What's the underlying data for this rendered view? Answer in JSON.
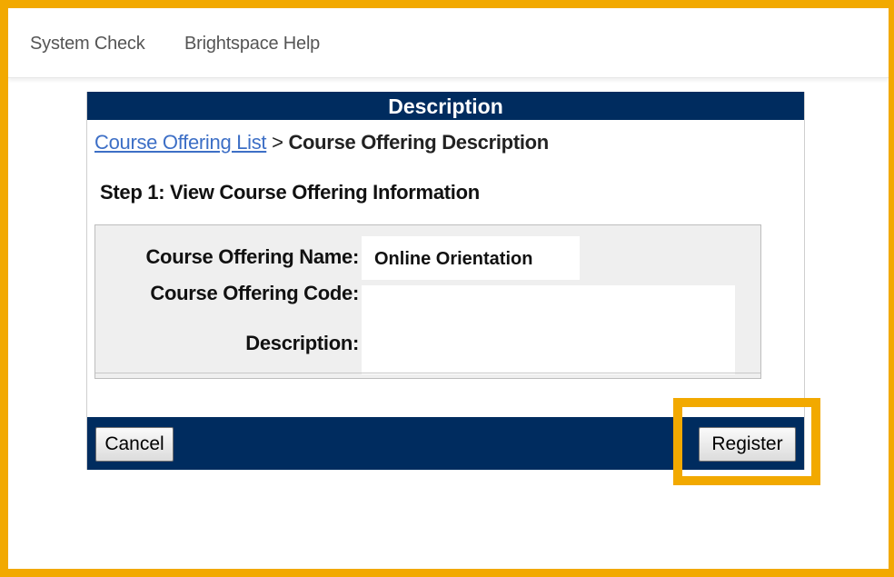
{
  "topbar": {
    "links": [
      {
        "label": "System Check"
      },
      {
        "label": "Brightspace Help"
      }
    ]
  },
  "panel": {
    "header": "Description",
    "breadcrumb": {
      "link": "Course Offering List",
      "separator": ">",
      "current": "Course Offering Description"
    },
    "step_title": "Step 1: View Course Offering Information",
    "fields": {
      "name_label": "Course Offering Name:",
      "name_value": "Online Orientation",
      "code_label": "Course Offering Code:",
      "code_value": "",
      "description_label": "Description:",
      "description_value": ""
    }
  },
  "footer": {
    "cancel_label": "Cancel",
    "register_label": "Register"
  },
  "colors": {
    "header_bg": "#002c5f",
    "highlight": "#f2a900",
    "link": "#3d6fc6"
  }
}
